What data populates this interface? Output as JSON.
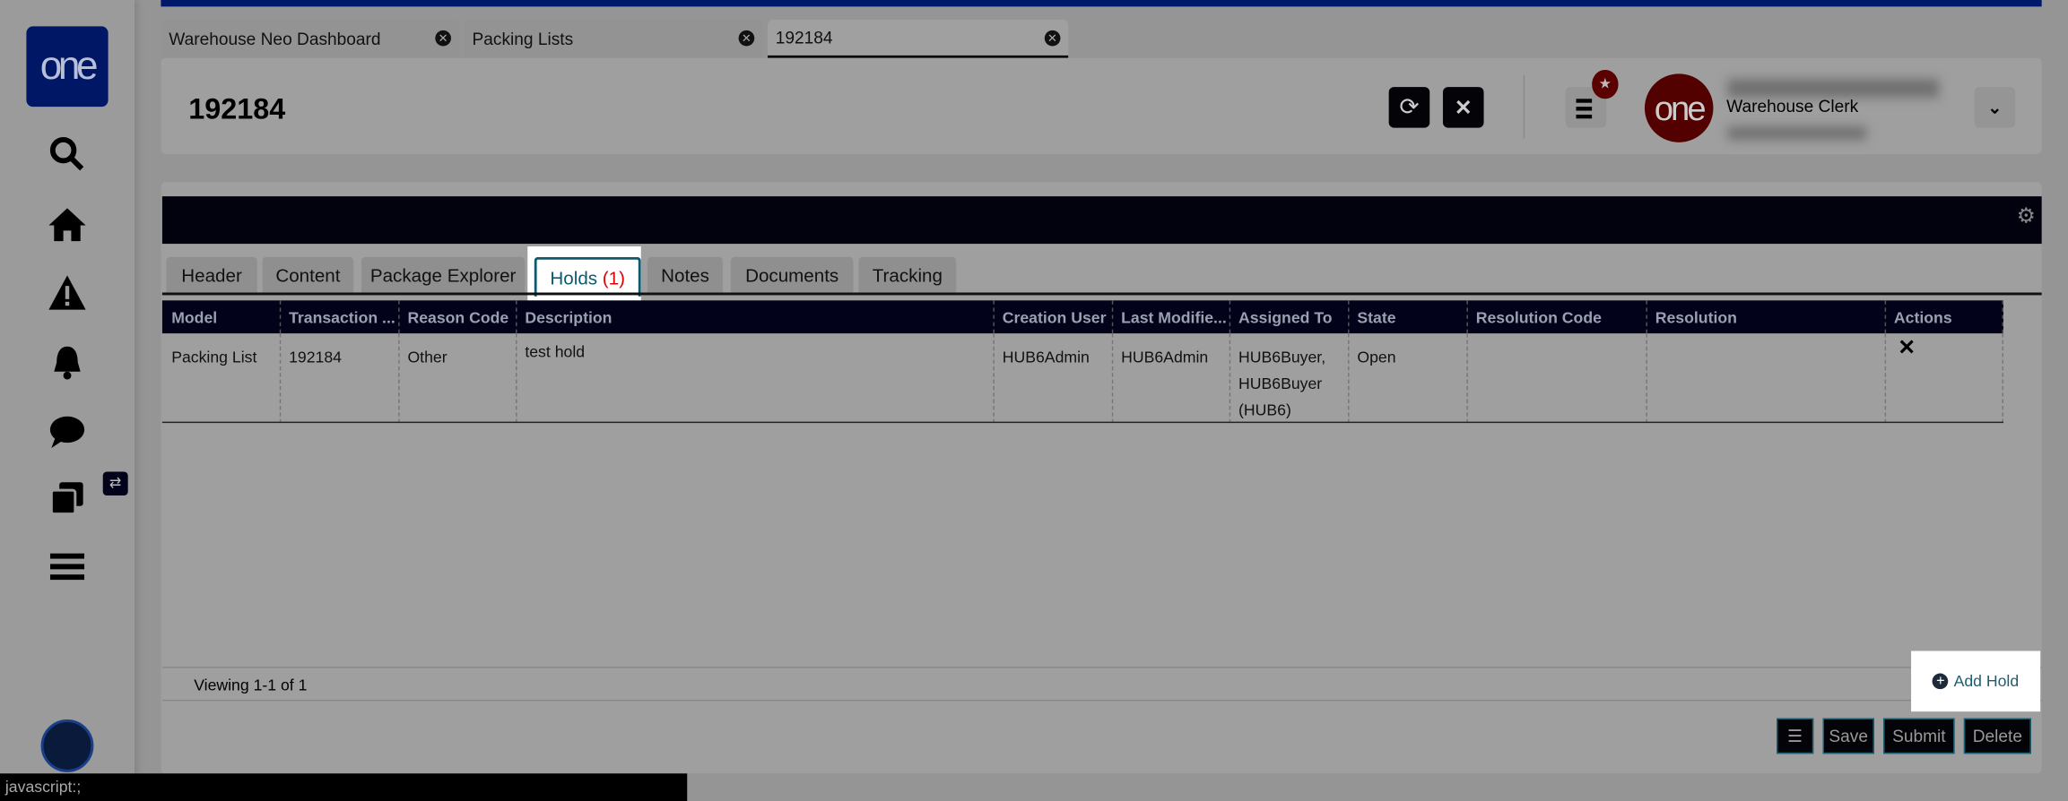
{
  "app": {
    "logo_text": "one"
  },
  "sidebar": {
    "items": [
      "search",
      "home",
      "alerts",
      "notifications",
      "messages",
      "copy",
      "menu"
    ]
  },
  "window_tabs": [
    {
      "label": "Warehouse Neo Dashboard"
    },
    {
      "label": "Packing Lists"
    },
    {
      "label": "192184"
    }
  ],
  "header": {
    "title": "192184",
    "user_role": "Warehouse Clerk",
    "avatar_text": "one"
  },
  "sub_tabs": [
    {
      "label": "Header"
    },
    {
      "label": "Content"
    },
    {
      "label": "Package Explorer"
    },
    {
      "label": "Holds",
      "count": "(1)"
    },
    {
      "label": "Notes"
    },
    {
      "label": "Documents"
    },
    {
      "label": "Tracking"
    }
  ],
  "table": {
    "columns": [
      "Model",
      "Transaction ...",
      "Reason Code",
      "Description",
      "Creation User",
      "Last Modifie...",
      "Assigned To",
      "State",
      "Resolution Code",
      "Resolution",
      "Actions"
    ],
    "rows": [
      [
        "Packing List",
        "192184",
        "Other",
        "test hold",
        "HUB6Admin",
        "HUB6Admin",
        "HUB6Buyer, HUB6Buyer (HUB6)",
        "Open",
        "",
        "",
        ""
      ]
    ]
  },
  "footer": {
    "viewing": "Viewing 1-1 of 1",
    "add_hold": "Add Hold"
  },
  "actions": {
    "save": "Save",
    "submit": "Submit",
    "delete": "Delete"
  },
  "status_bar": "javascript:;",
  "colors": {
    "brand": "#00186a",
    "alert": "#e00000"
  }
}
